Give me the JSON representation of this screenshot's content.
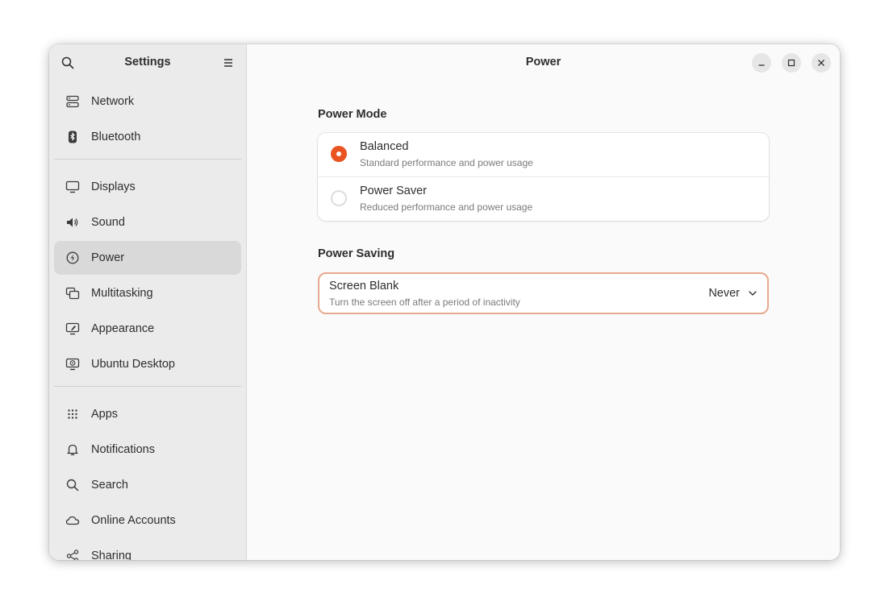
{
  "sidebar": {
    "title": "Settings",
    "groups": [
      [
        {
          "label": "Network",
          "icon": "network-icon"
        },
        {
          "label": "Bluetooth",
          "icon": "bluetooth-icon"
        }
      ],
      [
        {
          "label": "Displays",
          "icon": "display-icon"
        },
        {
          "label": "Sound",
          "icon": "speaker-icon"
        },
        {
          "label": "Power",
          "icon": "power-icon",
          "active": true
        },
        {
          "label": "Multitasking",
          "icon": "multitasking-icon"
        },
        {
          "label": "Appearance",
          "icon": "appearance-icon"
        },
        {
          "label": "Ubuntu Desktop",
          "icon": "ubuntu-desktop-icon"
        }
      ],
      [
        {
          "label": "Apps",
          "icon": "apps-grid-icon"
        },
        {
          "label": "Notifications",
          "icon": "bell-icon"
        },
        {
          "label": "Search",
          "icon": "search-icon"
        },
        {
          "label": "Online Accounts",
          "icon": "cloud-icon"
        },
        {
          "label": "Sharing",
          "icon": "share-icon"
        }
      ]
    ]
  },
  "header": {
    "title": "Power"
  },
  "power_mode": {
    "section_title": "Power Mode",
    "options": [
      {
        "title": "Balanced",
        "subtitle": "Standard performance and power usage",
        "selected": true
      },
      {
        "title": "Power Saver",
        "subtitle": "Reduced performance and power usage",
        "selected": false
      }
    ]
  },
  "power_saving": {
    "section_title": "Power Saving",
    "screen_blank": {
      "title": "Screen Blank",
      "subtitle": "Turn the screen off after a period of inactivity",
      "value": "Never"
    }
  },
  "colors": {
    "accent": "#e95420",
    "focus_border": "#e8a88f",
    "sidebar_bg": "#ebebeb",
    "content_bg": "#fafafa"
  }
}
